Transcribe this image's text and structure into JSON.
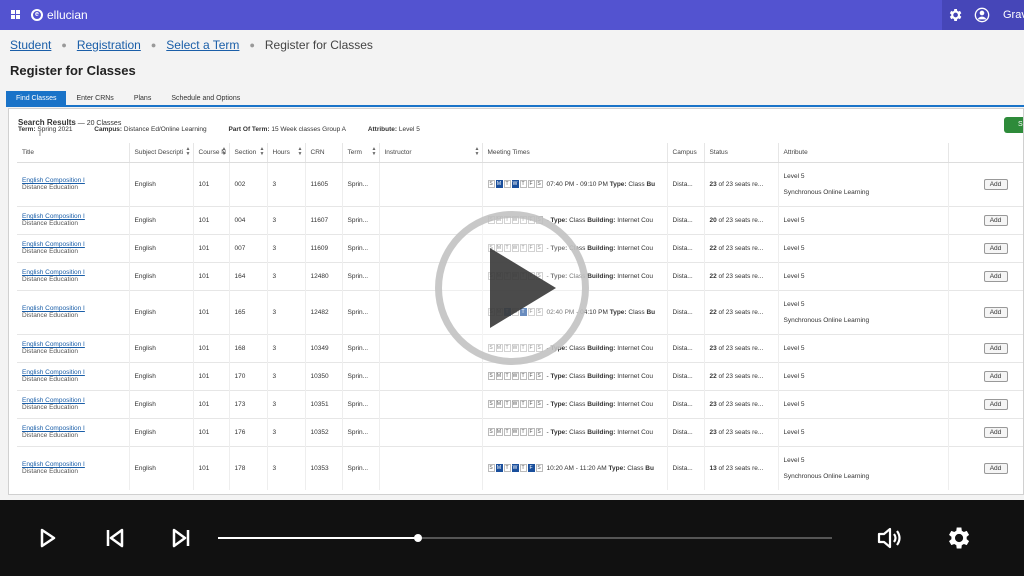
{
  "topbar": {
    "brand": "ellucian",
    "logo_mark": "e",
    "username": "Grav"
  },
  "breadcrumb": {
    "items": [
      "Student",
      "Registration",
      "Select a Term"
    ],
    "current": "Register for Classes",
    "sep": "●"
  },
  "page_title": "Register for Classes",
  "tabs": [
    "Find Classes",
    "Enter CRNs",
    "Plans",
    "Schedule and Options"
  ],
  "search": {
    "heading": "Search Results",
    "count": " — 20 Classes",
    "term_label": "Term:",
    "term_value": "Spring 2021",
    "campus_label": "Campus:",
    "campus_value": "Distance Ed/Online Learning",
    "pot_label": "Part Of Term:",
    "pot_value": "15 Week classes Group A",
    "attr_label": "Attribute:",
    "attr_value": "Level 5",
    "green_button_label": "S"
  },
  "columns": [
    "Title",
    "Subject Descripti",
    "Course N",
    "Section",
    "Hours",
    "CRN",
    "Term",
    "Instructor",
    "Meeting Times",
    "Campus",
    "Status",
    "Attribute",
    ""
  ],
  "day_letters": [
    "S",
    "M",
    "T",
    "W",
    "T",
    "F",
    "S"
  ],
  "rows": [
    {
      "title": "English Composition I",
      "sub": "Distance Education",
      "subject": "English",
      "course": "101",
      "section": "002",
      "hours": "3",
      "crn": "11605",
      "term": "Sprin...",
      "days": [
        false,
        true,
        false,
        true,
        false,
        false,
        false
      ],
      "time": "07:40 PM - 09:10 PM",
      "type_label": "Type:",
      "type": "Class",
      "bldg_label": "Bu",
      "bldg": "",
      "campus": "Dista...",
      "seats": "23",
      "seats_rest": " of 23 seats re...",
      "attr1": "Level 5",
      "attr2": "Synchronous Online Learning",
      "add": "Add"
    },
    {
      "title": "English Composition I",
      "sub": "Distance Education",
      "subject": "English",
      "course": "101",
      "section": "004",
      "hours": "3",
      "crn": "11607",
      "term": "Sprin...",
      "days": [
        false,
        false,
        false,
        false,
        false,
        false,
        false
      ],
      "time": "-",
      "type_label": "Type:",
      "type": "Class",
      "bldg_label": "Building:",
      "bldg": "Internet Cou",
      "campus": "Dista...",
      "seats": "20",
      "seats_rest": " of 23 seats re...",
      "attr1": "Level 5",
      "attr2": "",
      "add": "Add"
    },
    {
      "title": "English Composition I",
      "sub": "Distance Education",
      "subject": "English",
      "course": "101",
      "section": "007",
      "hours": "3",
      "crn": "11609",
      "term": "Sprin...",
      "days": [
        false,
        false,
        false,
        false,
        false,
        false,
        false
      ],
      "time": "-",
      "type_label": "Type:",
      "type": "Class",
      "bldg_label": "Building:",
      "bldg": "Internet Cou",
      "campus": "Dista...",
      "seats": "22",
      "seats_rest": " of 23 seats re...",
      "attr1": "Level 5",
      "attr2": "",
      "add": "Add"
    },
    {
      "title": "English Composition I",
      "sub": "Distance Education",
      "subject": "English",
      "course": "101",
      "section": "164",
      "hours": "3",
      "crn": "12480",
      "term": "Sprin...",
      "days": [
        false,
        false,
        false,
        false,
        false,
        false,
        false
      ],
      "time": "-",
      "type_label": "Type:",
      "type": "Class",
      "bldg_label": "Building:",
      "bldg": "Internet Cou",
      "campus": "Dista...",
      "seats": "22",
      "seats_rest": " of 23 seats re...",
      "attr1": "Level 5",
      "attr2": "",
      "add": "Add"
    },
    {
      "title": "English Composition I",
      "sub": "Distance Education",
      "subject": "English",
      "course": "101",
      "section": "165",
      "hours": "3",
      "crn": "12482",
      "term": "Sprin...",
      "days": [
        false,
        false,
        true,
        false,
        true,
        false,
        false
      ],
      "time": "02:40 PM - 04:10 PM",
      "type_label": "Type:",
      "type": "Class",
      "bldg_label": "Bu",
      "bldg": "",
      "campus": "Dista...",
      "seats": "22",
      "seats_rest": " of 23 seats re...",
      "attr1": "Level 5",
      "attr2": "Synchronous Online Learning",
      "add": "Add"
    },
    {
      "title": "English Composition I",
      "sub": "Distance Education",
      "subject": "English",
      "course": "101",
      "section": "168",
      "hours": "3",
      "crn": "10349",
      "term": "Sprin...",
      "days": [
        false,
        false,
        false,
        false,
        false,
        false,
        false
      ],
      "time": "-",
      "type_label": "Type:",
      "type": "Class",
      "bldg_label": "Building:",
      "bldg": "Internet Cou",
      "campus": "Dista...",
      "seats": "23",
      "seats_rest": " of 23 seats re...",
      "attr1": "Level 5",
      "attr2": "",
      "add": "Add"
    },
    {
      "title": "English Composition I",
      "sub": "Distance Education",
      "subject": "English",
      "course": "101",
      "section": "170",
      "hours": "3",
      "crn": "10350",
      "term": "Sprin...",
      "days": [
        false,
        false,
        false,
        false,
        false,
        false,
        false
      ],
      "time": "-",
      "type_label": "Type:",
      "type": "Class",
      "bldg_label": "Building:",
      "bldg": "Internet Cou",
      "campus": "Dista...",
      "seats": "22",
      "seats_rest": " of 23 seats re...",
      "attr1": "Level 5",
      "attr2": "",
      "add": "Add"
    },
    {
      "title": "English Composition I",
      "sub": "Distance Education",
      "subject": "English",
      "course": "101",
      "section": "173",
      "hours": "3",
      "crn": "10351",
      "term": "Sprin...",
      "days": [
        false,
        false,
        false,
        false,
        false,
        false,
        false
      ],
      "time": "-",
      "type_label": "Type:",
      "type": "Class",
      "bldg_label": "Building:",
      "bldg": "Internet Cou",
      "campus": "Dista...",
      "seats": "23",
      "seats_rest": " of 23 seats re...",
      "attr1": "Level 5",
      "attr2": "",
      "add": "Add"
    },
    {
      "title": "English Composition I",
      "sub": "Distance Education",
      "subject": "English",
      "course": "101",
      "section": "176",
      "hours": "3",
      "crn": "10352",
      "term": "Sprin...",
      "days": [
        false,
        false,
        false,
        false,
        false,
        false,
        false
      ],
      "time": "-",
      "type_label": "Type:",
      "type": "Class",
      "bldg_label": "Building:",
      "bldg": "Internet Cou",
      "campus": "Dista...",
      "seats": "23",
      "seats_rest": " of 23 seats re...",
      "attr1": "Level 5",
      "attr2": "",
      "add": "Add"
    },
    {
      "title": "English Composition I",
      "sub": "Distance Education",
      "subject": "English",
      "course": "101",
      "section": "178",
      "hours": "3",
      "crn": "10353",
      "term": "Sprin...",
      "days": [
        false,
        true,
        false,
        true,
        false,
        true,
        false
      ],
      "time": "10:20 AM - 11:20 AM",
      "type_label": "Type:",
      "type": "Class",
      "bldg_label": "Bu",
      "bldg": "",
      "campus": "Dista...",
      "seats": "13",
      "seats_rest": " of 23 seats re...",
      "attr1": "Level 5",
      "attr2": "Synchronous Online Learning",
      "add": "Add"
    }
  ],
  "player": {
    "progress_fraction": 0.326
  },
  "icons": {
    "play": "play-icon",
    "prev": "skip-previous-icon",
    "next": "skip-next-icon",
    "volume": "volume-icon",
    "settings": "settings-gear-icon"
  },
  "colors": {
    "topbar": "#5353d0",
    "tab_active": "#1a73c8",
    "link": "#1a5ea8",
    "day_on": "#1a4f9c",
    "green": "#2e8b3a"
  }
}
